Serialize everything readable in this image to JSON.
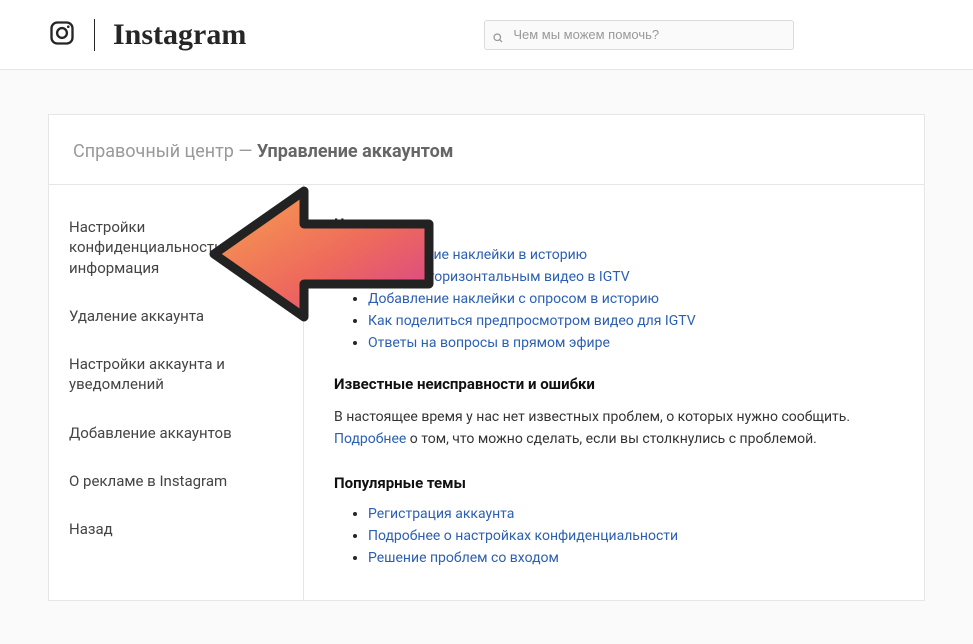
{
  "header": {
    "brand": "Instagram",
    "search_placeholder": "Чем мы можем помочь?"
  },
  "breadcrumb": {
    "root": "Справочный центр",
    "sep": " — ",
    "current": "Управление аккаунтом"
  },
  "sidebar": {
    "items": [
      {
        "label": "Настройки конфиденциальности и информация"
      },
      {
        "label": "Удаление аккаунта"
      },
      {
        "label": "Настройки аккаунта и уведомлений"
      },
      {
        "label": "Добавление аккаунтов"
      },
      {
        "label": "О рекламе в Instagram"
      },
      {
        "label": "Назад"
      }
    ]
  },
  "content": {
    "whats_new": {
      "title": "Что нового",
      "links": [
        "Добавление наклейки в историю",
        "Работа с горизонтальным видео в IGTV",
        "Добавление наклейки с опросом в историю",
        "Как поделиться предпросмотром видео для IGTV",
        "Ответы на вопросы в прямом эфире"
      ]
    },
    "issues": {
      "title": "Известные неисправности и ошибки",
      "body_pre": "В настоящее время у нас нет известных проблем, о которых нужно сообщить. ",
      "link": "Подробнее",
      "body_post": " о том, что можно сделать, если вы столкнулись с проблемой."
    },
    "popular": {
      "title": "Популярные темы",
      "links": [
        "Регистрация аккаунта",
        "Подробнее о настройках конфиденциальности",
        "Решение проблем со входом"
      ]
    }
  }
}
